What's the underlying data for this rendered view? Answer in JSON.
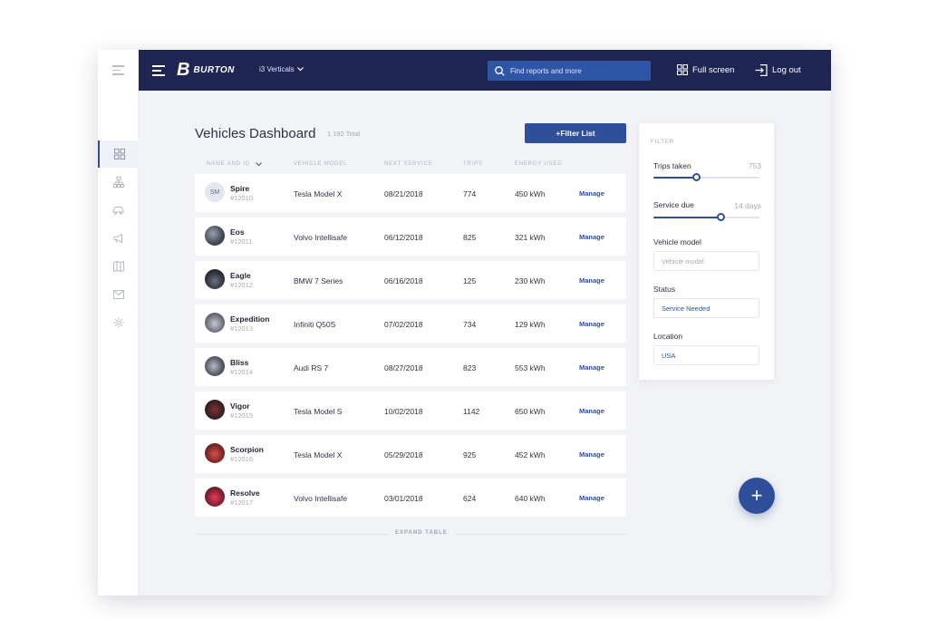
{
  "brand": {
    "mark": "B",
    "name": "BURTON"
  },
  "header": {
    "vertical_label": "i3 Verticals",
    "search_placeholder": "Find reports and more",
    "fullscreen_label": "Full screen",
    "logout_label": "Log out"
  },
  "main": {
    "title": "Vehicles Dashboard",
    "total": "1 192 Total",
    "filter_button": "+Filter List",
    "expand_label": "EXPAND TABLE"
  },
  "table": {
    "columns": [
      "NAME AND ID",
      "VEHICLE MODEL",
      "NEXT SERVICE",
      "TRIPS",
      "ENERGY USED"
    ],
    "action_label": "Manage",
    "rows": [
      {
        "name": "Spire",
        "id": "#12010",
        "initials": "SM",
        "model": "Tesla Model X",
        "service": "08/21/2018",
        "trips": "774",
        "energy": "450 kWh"
      },
      {
        "name": "Eos",
        "id": "#12011",
        "initials": "",
        "model": "Volvo Intellisafe",
        "service": "06/12/2018",
        "trips": "825",
        "energy": "321 kWh"
      },
      {
        "name": "Eagle",
        "id": "#12012",
        "initials": "",
        "model": "BMW 7 Series",
        "service": "06/16/2018",
        "trips": "125",
        "energy": "230 kWh"
      },
      {
        "name": "Expedition",
        "id": "#12013",
        "initials": "",
        "model": "Infiniti Q50S",
        "service": "07/02/2018",
        "trips": "734",
        "energy": "129 kWh"
      },
      {
        "name": "Bliss",
        "id": "#12014",
        "initials": "",
        "model": "Audi RS 7",
        "service": "08/27/2018",
        "trips": "823",
        "energy": "553 kWh"
      },
      {
        "name": "Vigor",
        "id": "#12015",
        "initials": "",
        "model": "Tesla Model S",
        "service": "10/02/2018",
        "trips": "1142",
        "energy": "650 kWh"
      },
      {
        "name": "Scorpion",
        "id": "#12016",
        "initials": "",
        "model": "Tesla Model X",
        "service": "05/29/2018",
        "trips": "925",
        "energy": "452 kWh"
      },
      {
        "name": "Resolve",
        "id": "#12017",
        "initials": "",
        "model": "Volvo Intellisafe",
        "service": "03/01/2018",
        "trips": "624",
        "energy": "640 kWh"
      }
    ]
  },
  "filter": {
    "title": "FILTER",
    "trips": {
      "label": "Trips taken",
      "value": "753",
      "level": 0.4
    },
    "service": {
      "label": "Service due",
      "value": "14 days",
      "level": 0.63
    },
    "model": {
      "label": "Vehicle model",
      "placeholder": "Vehicle model"
    },
    "status": {
      "label": "Status",
      "value": "Service Needed"
    },
    "location": {
      "label": "Location",
      "value": "USA"
    }
  },
  "fab_label": "+",
  "colors": {
    "topbar": "#1f2553",
    "accent": "#2f4f9b",
    "search": "#2f56a6",
    "background": "#f2f3f6"
  },
  "icons": {
    "rail": [
      "grid-icon",
      "hierarchy-icon",
      "car-icon",
      "megaphone-icon",
      "map-icon",
      "mail-icon",
      "gear-icon"
    ],
    "header": [
      "menu-icon",
      "search-icon",
      "fullscreen-icon",
      "logout-icon",
      "chevron-down-icon"
    ]
  }
}
